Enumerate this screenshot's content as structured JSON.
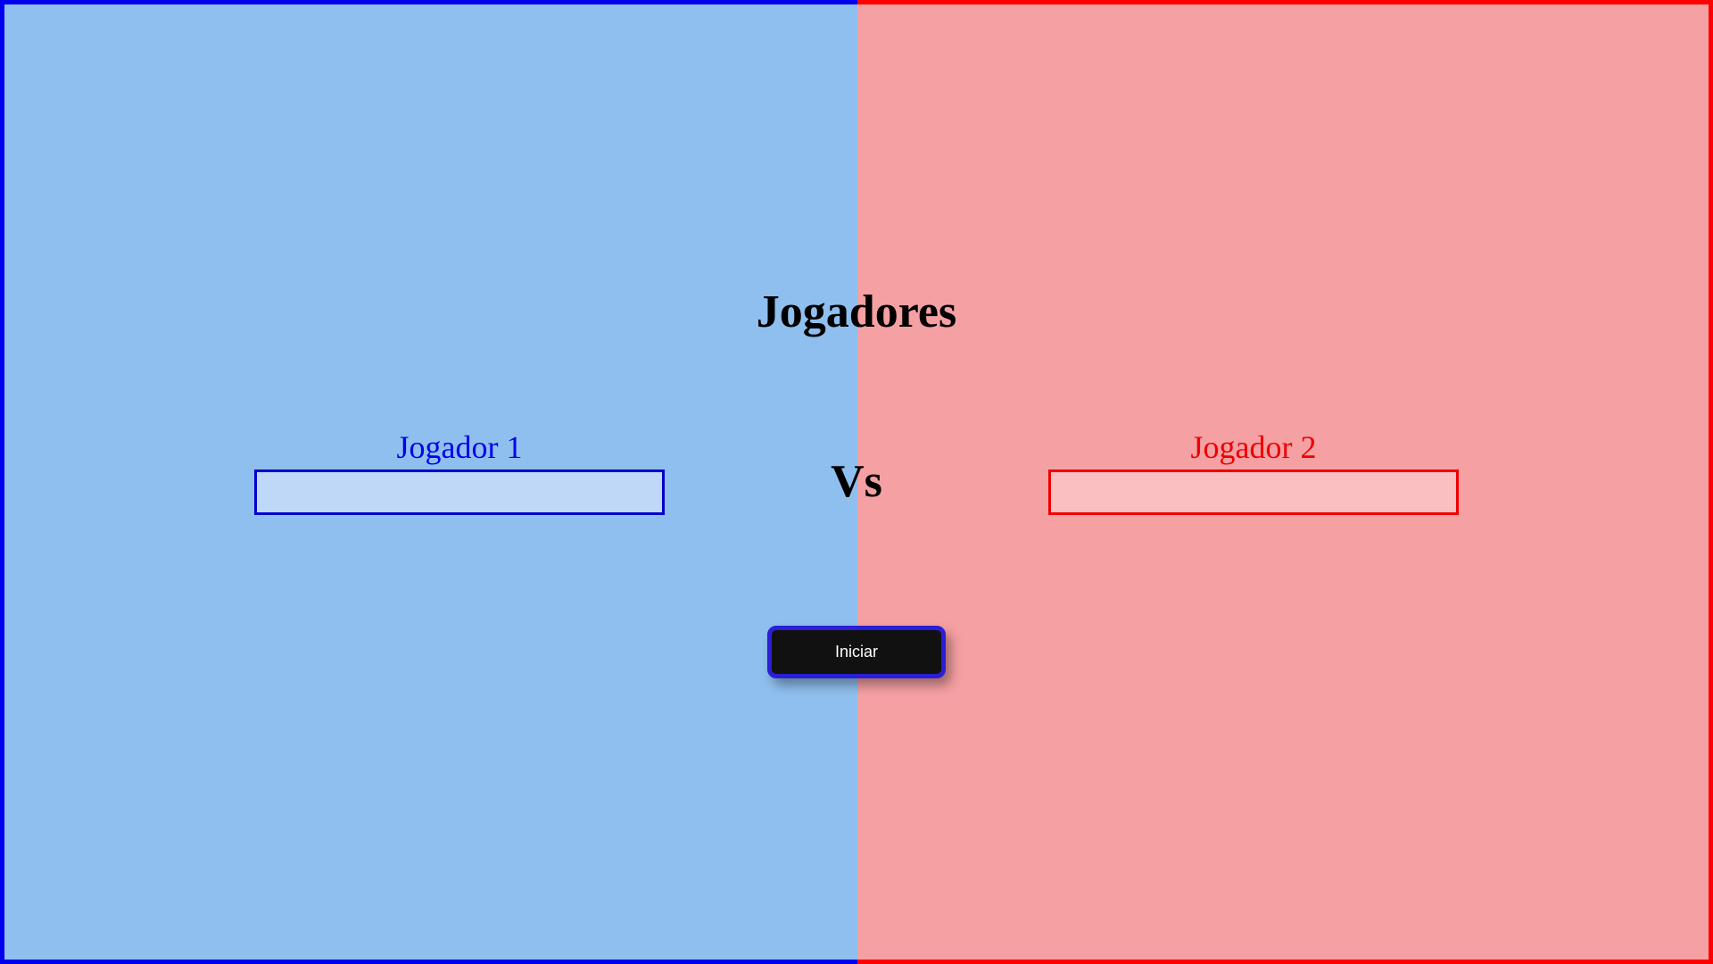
{
  "title": "Jogadores",
  "vs_label": "Vs",
  "players": [
    {
      "label": "Jogador 1",
      "value": "",
      "color": "#0000ee"
    },
    {
      "label": "Jogador 2",
      "value": "",
      "color": "#ee0000"
    }
  ],
  "start_button": {
    "label": "Iniciar"
  },
  "colors": {
    "left_background": "#8fbfee",
    "right_background": "#f5a0a3",
    "left_border": "#0000ee",
    "right_border": "#ff0000",
    "button_background": "#111111",
    "button_border": "#2a1fd6"
  }
}
